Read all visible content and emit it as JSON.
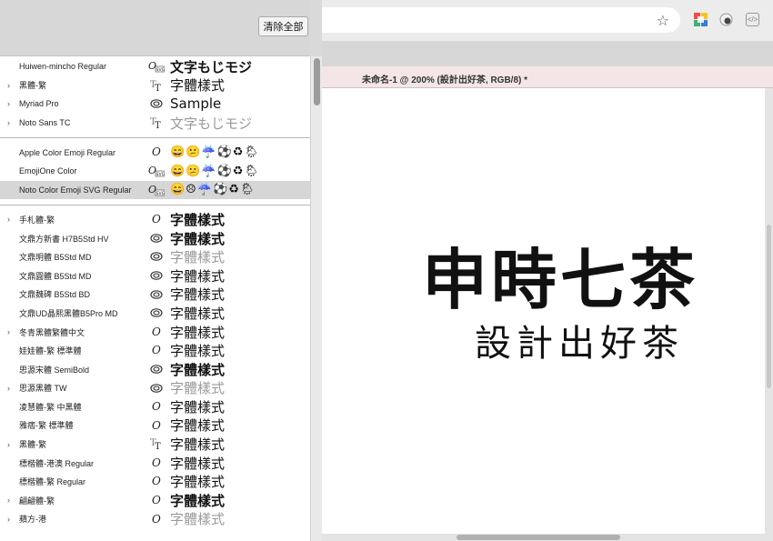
{
  "panel": {
    "clear_all": "清除全部",
    "groups": [
      [
        {
          "name": "Huiwen-mincho Regular",
          "chevron": false,
          "icon": "otf-svg-icon",
          "sample": "文字もじモジ",
          "style": "bold"
        },
        {
          "name": "黑體-繁",
          "chevron": true,
          "icon": "truetype-icon",
          "sample": "字體樣式",
          "style": "sans"
        },
        {
          "name": "Myriad Pro",
          "chevron": true,
          "icon": "adobe-cloud-icon",
          "sample": "Sample",
          "style": "sans"
        },
        {
          "name": "Noto Sans TC",
          "chevron": true,
          "icon": "truetype-icon",
          "sample": "文字もじモジ",
          "style": "sans grey"
        }
      ],
      [
        {
          "name": "Apple Color Emoji Regular",
          "chevron": false,
          "icon": "opentype-icon",
          "sample": "😄😕☔⚽♻🌦",
          "style": "emoji"
        },
        {
          "name": "EmojiOne Color",
          "chevron": false,
          "icon": "otf-svg-icon",
          "sample": "😄😕☔⚽♻🌦",
          "style": "emoji"
        },
        {
          "name": "Noto Color Emoji SVG Regular",
          "chevron": false,
          "icon": "otf-svg-icon",
          "sample": "😄☹☔⚽♻🌦",
          "style": "emoji",
          "selected": true
        }
      ],
      [
        {
          "name": "手札體-繁",
          "chevron": true,
          "icon": "opentype-icon",
          "sample": "字體樣式",
          "style": "bold"
        },
        {
          "name": "文鼎方新書 H7B5Std HV",
          "chevron": false,
          "icon": "adobe-cloud-icon",
          "sample": "字體樣式",
          "style": "bold"
        },
        {
          "name": "文鼎明體 B5Std MD",
          "chevron": false,
          "icon": "adobe-cloud-icon",
          "sample": "字體樣式",
          "style": "grey"
        },
        {
          "name": "文鼎圓體 B5Std MD",
          "chevron": false,
          "icon": "adobe-cloud-icon",
          "sample": "字體樣式",
          "style": ""
        },
        {
          "name": "文鼎魏碑 B5Std BD",
          "chevron": false,
          "icon": "adobe-cloud-icon",
          "sample": "字體樣式",
          "style": ""
        },
        {
          "name": "文鼎UD晶熙黑體B5Pro MD",
          "chevron": false,
          "icon": "adobe-cloud-icon",
          "sample": "字體樣式",
          "style": "sans"
        },
        {
          "name": "冬青黑體繁體中文",
          "chevron": true,
          "icon": "opentype-icon",
          "sample": "字體樣式",
          "style": "sans"
        },
        {
          "name": "娃娃體-繁 標準體",
          "chevron": false,
          "icon": "opentype-icon",
          "sample": "字體樣式",
          "style": ""
        },
        {
          "name": "思源宋體 SemiBold",
          "chevron": false,
          "icon": "adobe-cloud-icon",
          "sample": "字體樣式",
          "style": "bold"
        },
        {
          "name": "思源黑體 TW",
          "chevron": true,
          "icon": "adobe-cloud-icon",
          "sample": "字體樣式",
          "style": "sans grey"
        },
        {
          "name": "凌慧體-繁 中黑體",
          "chevron": false,
          "icon": "opentype-icon",
          "sample": "字體樣式",
          "style": ""
        },
        {
          "name": "雅痞-繁 標準體",
          "chevron": false,
          "icon": "opentype-icon",
          "sample": "字體樣式",
          "style": "sans"
        },
        {
          "name": "黑體-繁",
          "chevron": true,
          "icon": "truetype-icon",
          "sample": "字體樣式",
          "style": "sans"
        },
        {
          "name": "標楷體-港澳 Regular",
          "chevron": false,
          "icon": "opentype-icon",
          "sample": "字體樣式",
          "style": ""
        },
        {
          "name": "標楷體-繁 Regular",
          "chevron": false,
          "icon": "opentype-icon",
          "sample": "字體樣式",
          "style": ""
        },
        {
          "name": "翩翩體-繁",
          "chevron": true,
          "icon": "opentype-icon",
          "sample": "字體樣式",
          "style": "bold"
        },
        {
          "name": "蘋方-港",
          "chevron": true,
          "icon": "opentype-icon",
          "sample": "字體樣式",
          "style": "sans grey"
        }
      ]
    ]
  },
  "document": {
    "tab_title": "未命名-1 @ 200% (設計出好茶, RGB/8) *",
    "logo_main": "申時七茶",
    "logo_sub": "設計出好茶"
  },
  "browser": {
    "extension_icons": [
      "palette-extension-icon",
      "circle-extension-icon",
      "code-extension-icon"
    ],
    "code_icon_text": "</>"
  }
}
